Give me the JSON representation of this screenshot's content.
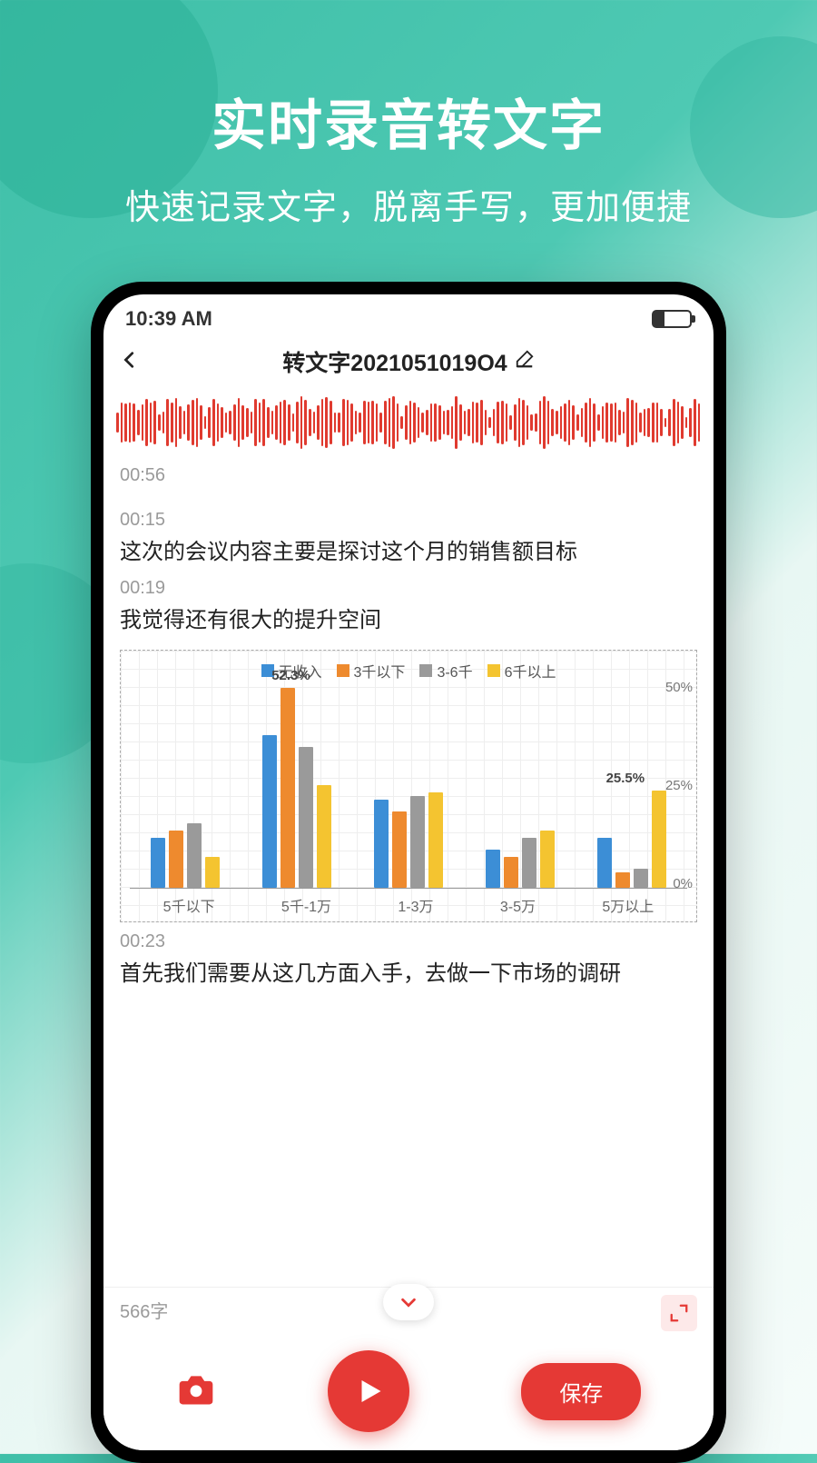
{
  "hero": {
    "title": "实时录音转文字",
    "subtitle": "快速记录文字，脱离手写，更加便捷"
  },
  "status": {
    "time": "10:39 AM"
  },
  "nav": {
    "title": "转文字2021051019O4"
  },
  "playback_position": "00:56",
  "transcript": [
    {
      "ts": "00:15",
      "text": "这次的会议内容主要是探讨这个月的销售额目标"
    },
    {
      "ts": "00:19",
      "text": "我觉得还有很大的提升空间"
    },
    {
      "ts": "00:23",
      "text": "首先我们需要从这几方面入手，去做一下市场的调研"
    }
  ],
  "char_count_label": "566字",
  "save_label": "保存",
  "colors": {
    "accent": "#e53935",
    "series": [
      "#3c8ed6",
      "#ee8a2e",
      "#9a9a9a",
      "#f4c430"
    ]
  },
  "chart_data": {
    "type": "bar",
    "title": "",
    "xlabel": "",
    "ylabel": "",
    "ylim": [
      0,
      50
    ],
    "y_ticks": [
      "50%",
      "25%",
      "0%"
    ],
    "legend": [
      "无收入",
      "3千以下",
      "3-6千",
      "6千以上"
    ],
    "categories": [
      "5千以下",
      "5千-1万",
      "1-3万",
      "3-5万",
      "5万以上"
    ],
    "series": [
      {
        "name": "无收入",
        "values": [
          13,
          40,
          23,
          10,
          13
        ]
      },
      {
        "name": "3千以下",
        "values": [
          15,
          52.3,
          20,
          8,
          4
        ]
      },
      {
        "name": "3-6千",
        "values": [
          17,
          37,
          24,
          13,
          5
        ]
      },
      {
        "name": "6千以上",
        "values": [
          8,
          27,
          25,
          15,
          25.5
        ]
      }
    ],
    "annotations": [
      {
        "group_index": 1,
        "text": "52.3%"
      },
      {
        "group_index": 4,
        "text": "25.5%"
      }
    ]
  }
}
